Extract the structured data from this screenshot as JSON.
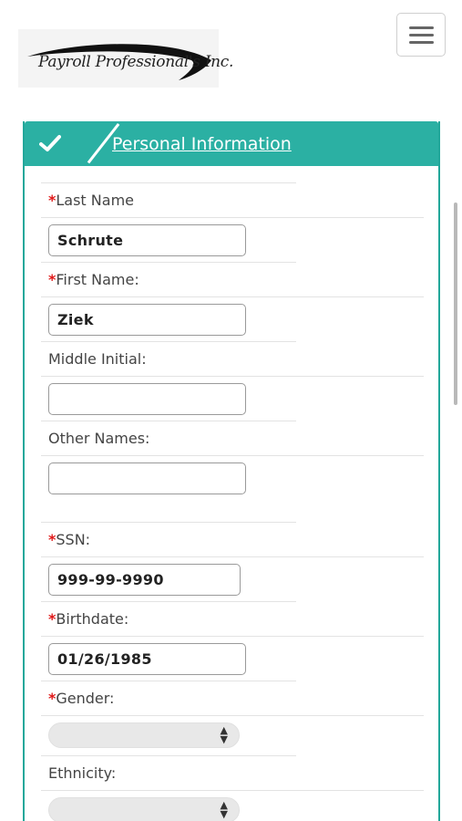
{
  "header": {
    "logo_text": "Payroll Professional's Inc.",
    "menu_icon": "hamburger-menu-icon"
  },
  "panel": {
    "title": "Personal Information",
    "status_icon": "checkmark-icon",
    "accent_color": "#2bb0a3"
  },
  "form": {
    "last_name": {
      "label": "Last Name",
      "required_mark": "*",
      "value": "Schrute"
    },
    "first_name": {
      "label": "First Name:",
      "required_mark": "*",
      "value": "Ziek"
    },
    "middle_initial": {
      "label": "Middle Initial:",
      "value": ""
    },
    "other_names": {
      "label": "Other Names:",
      "value": ""
    },
    "ssn": {
      "label": "SSN:",
      "required_mark": "*",
      "value": "999-99-9990"
    },
    "birthdate": {
      "label": "Birthdate:",
      "required_mark": "*",
      "value": "01/26/1985"
    },
    "gender": {
      "label": "Gender:",
      "required_mark": "*",
      "value": ""
    },
    "ethnicity": {
      "label": "Ethnicity:",
      "value": ""
    }
  },
  "colors": {
    "required": "#e01818",
    "border": "#22a79a"
  }
}
